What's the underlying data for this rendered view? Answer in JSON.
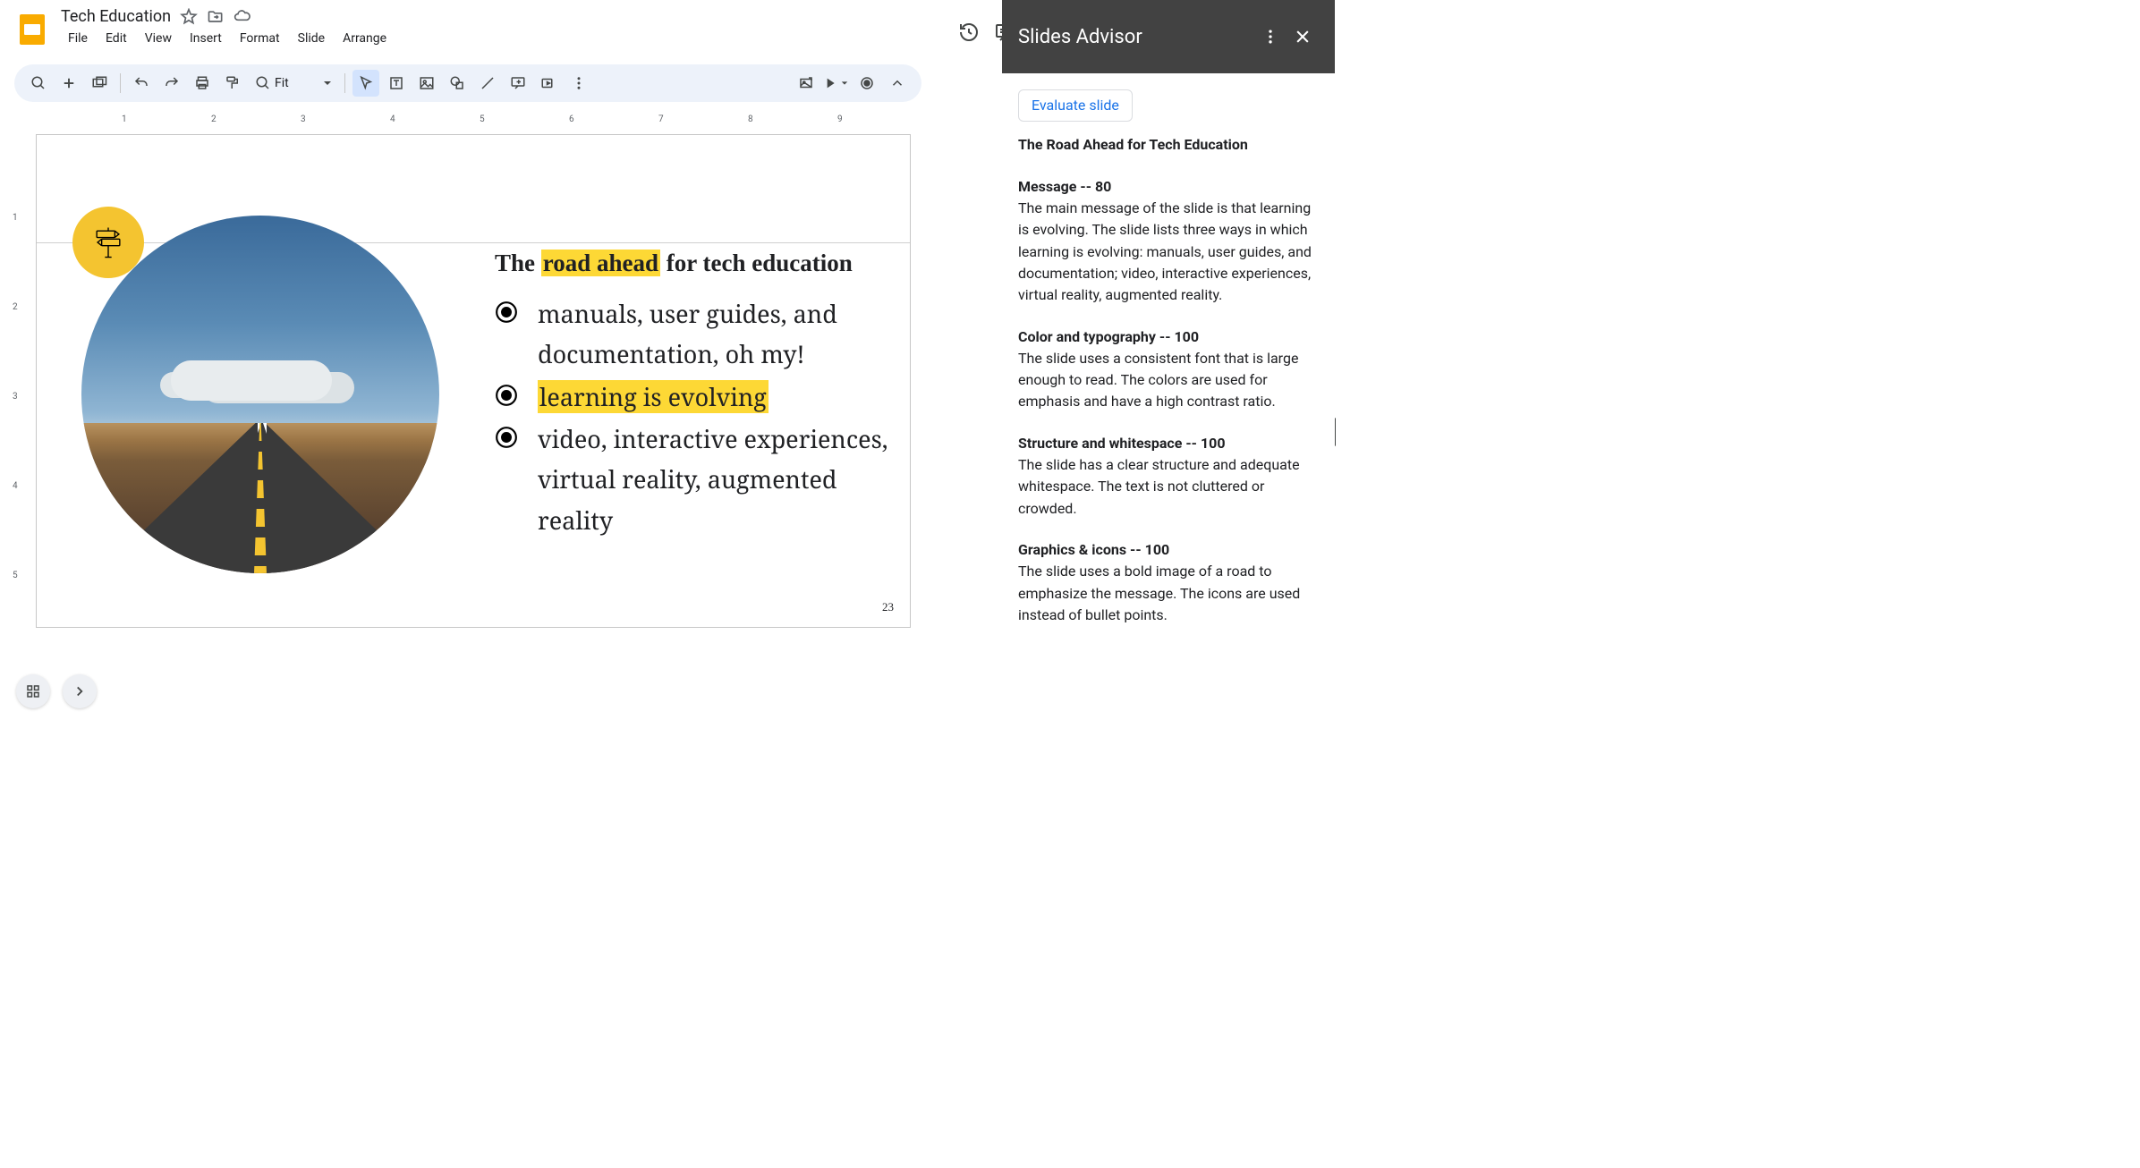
{
  "doc": {
    "title": "Tech Education"
  },
  "menu": {
    "file": "File",
    "edit": "Edit",
    "view": "View",
    "insert": "Insert",
    "format": "Format",
    "slide": "Slide",
    "arrange": "Arrange"
  },
  "header_actions": {
    "slideshow": "Slideshow"
  },
  "toolbar": {
    "zoom_label": "Fit"
  },
  "slide": {
    "title_pre": "The ",
    "title_hl": "road ahead",
    "title_post": " for tech education",
    "bullets": [
      {
        "prefix": "",
        "highlight": "",
        "text": "manuals, user guides, and documentation, oh my!"
      },
      {
        "prefix": "",
        "highlight": "learning is evolving",
        "text": ""
      },
      {
        "prefix": "",
        "highlight": "",
        "text": "video, interactive experiences, virtual reality, augmented reality"
      }
    ],
    "page_number": "23"
  },
  "advisor": {
    "title": "Slides Advisor",
    "evaluate_btn": "Evaluate slide",
    "slide_title": "The Road Ahead for Tech Education",
    "sections": [
      {
        "heading": "Message -- 80",
        "body": "The main message of the slide is that learning is evolving. The slide lists three ways in which learning is evolving: manuals, user guides, and documentation; video, interactive experiences, virtual reality, augmented reality."
      },
      {
        "heading": "Color and typography -- 100",
        "body": "The slide uses a consistent font that is large enough to read. The colors are used for emphasis and have a high contrast ratio."
      },
      {
        "heading": "Structure and whitespace -- 100",
        "body": "The slide has a clear structure and adequate whitespace. The text is not cluttered or crowded."
      },
      {
        "heading": "Graphics & icons -- 100",
        "body": "The slide uses a bold image of a road to emphasize the message. The icons are used instead of bullet points."
      }
    ]
  },
  "ruler_h": [
    "1",
    "2",
    "3",
    "4",
    "5",
    "6",
    "7",
    "8",
    "9"
  ],
  "ruler_v": [
    "1",
    "2",
    "3",
    "4",
    "5"
  ]
}
